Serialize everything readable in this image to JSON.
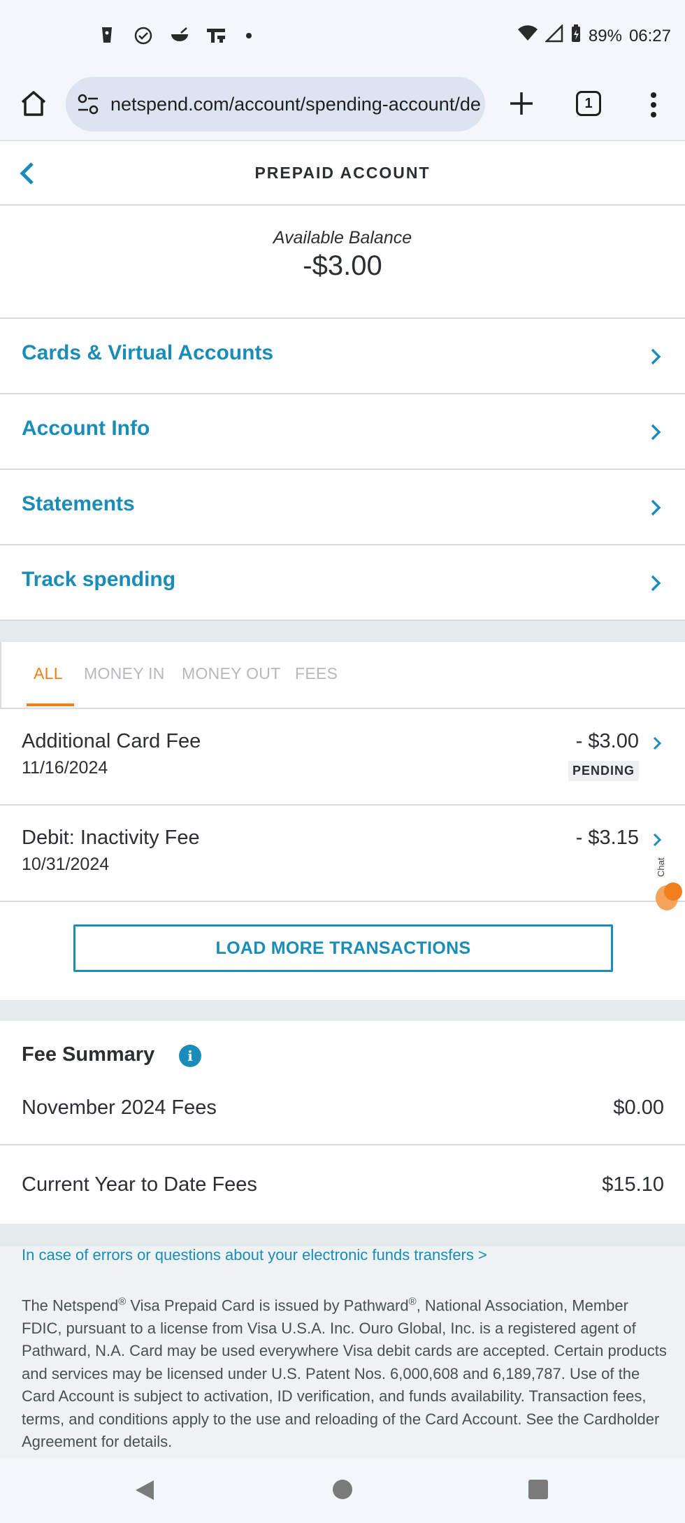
{
  "status_bar": {
    "battery": "89%",
    "time": "06:27"
  },
  "browser": {
    "url": "netspend.com/account/spending-account/de",
    "tab_count": "1"
  },
  "header": {
    "title": "PREPAID ACCOUNT"
  },
  "balance": {
    "label": "Available Balance",
    "value": "-$3.00"
  },
  "nav": {
    "items": [
      {
        "label": "Cards & Virtual Accounts"
      },
      {
        "label": "Account Info"
      },
      {
        "label": "Statements"
      },
      {
        "label": "Track spending"
      }
    ]
  },
  "tabs": {
    "items": [
      {
        "label": "ALL"
      },
      {
        "label": "MONEY IN"
      },
      {
        "label": "MONEY OUT"
      },
      {
        "label": "FEES"
      }
    ],
    "active": "ALL"
  },
  "transactions": [
    {
      "name": "Additional Card Fee",
      "date": "11/16/2024",
      "amount": "- $3.00",
      "status": "PENDING"
    },
    {
      "name": "Debit: Inactivity Fee",
      "date": "10/31/2024",
      "amount": "- $3.15",
      "status": ""
    }
  ],
  "load_more_label": "LOAD MORE TRANSACTIONS",
  "chat_label": "Chat",
  "fee_summary": {
    "title": "Fee Summary",
    "rows": [
      {
        "label": "November 2024 Fees",
        "value": "$0.00"
      },
      {
        "label": "Current Year to Date Fees",
        "value": "$15.10"
      }
    ]
  },
  "footer": {
    "link": "In case of errors or questions about your electronic funds transfers >",
    "disclaimer_parts": {
      "p1": "The Netspend",
      "reg1": "®",
      "p2": " Visa Prepaid Card is issued by Pathward",
      "reg2": "®",
      "p3": ", National Association, Member FDIC, pursuant to a license from Visa U.S.A. Inc. Ouro Global, Inc. is a registered agent of Pathward, N.A. Card may be used everywhere Visa debit cards are accepted. Certain products and services may be licensed under U.S. Patent Nos. 6,000,608 and 6,189,787. Use of the Card Account is subject to activation, ID verification, and funds availability. Transaction fees, terms, and conditions apply to the use and reloading of the Card Account. See the Cardholder Agreement for details."
    }
  },
  "colors": {
    "link_blue": "#1a8cb8",
    "active_orange": "#f07f1c",
    "divider": "#d8dcdf"
  }
}
